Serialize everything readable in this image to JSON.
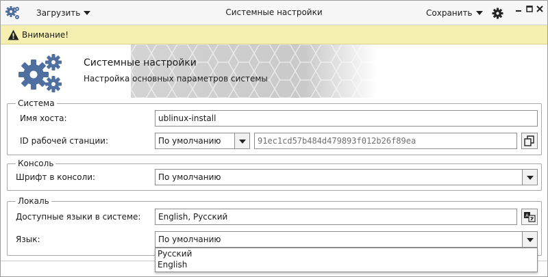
{
  "window": {
    "title": "Системные настройки",
    "load_label": "Загрузить",
    "save_label": "Сохранить"
  },
  "warning": {
    "text": "Внимание!"
  },
  "banner": {
    "title": "Системные настройки",
    "subtitle": "Настройка основных параметров системы"
  },
  "system": {
    "legend": "Система",
    "hostname_label": "Имя хоста:",
    "hostname_value": "ublinux-install",
    "machine_id_label": "ID рабочей станции:",
    "machine_id_mode": "По умолчанию",
    "machine_id_value": "91ec1cd57b484d479893f012b26f89ea"
  },
  "console": {
    "legend": "Консоль",
    "font_label": "Шрифт в консоли:",
    "font_value": "По умолчанию"
  },
  "locale": {
    "legend": "Локаль",
    "languages_label": "Доступные языки в системе:",
    "languages_value": "English, Русский",
    "language_label": "Язык:",
    "language_value": "По умолчанию",
    "language_options": [
      "Русский",
      "English"
    ]
  },
  "colors": {
    "accent_gear": "#4f6fa0",
    "warning_bg": "#f5f0b0"
  },
  "icons": [
    "app-gears-icon",
    "chevron-down-icon",
    "gear-icon",
    "minimize-icon",
    "maximize-icon",
    "close-icon",
    "warning-icon",
    "copy-icon",
    "language-icon"
  ]
}
